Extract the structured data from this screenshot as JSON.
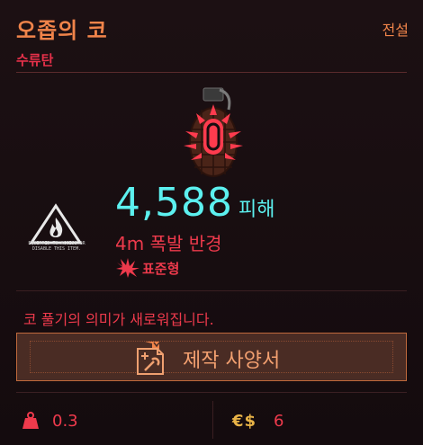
{
  "item": {
    "title": "오좁의 코",
    "rarity": "전설",
    "category": "수류탄"
  },
  "warning": {
    "text": "EQUIPPED TO ACCESS OR DISABLE THIS ITEM."
  },
  "stats": {
    "damage_value": "4,588",
    "damage_label": "피해",
    "radius": "4m 폭발 반경",
    "type_label": "표준형"
  },
  "description": "코 풀기의 의미가 새로워집니다.",
  "craft": {
    "label": "제작 사양서"
  },
  "footer": {
    "weight": "0.3",
    "price_icon": "€$",
    "price": "6"
  },
  "colors": {
    "accent_orange": "#f0844a",
    "accent_red": "#ee3a4c",
    "damage_cyan": "#5cf0ef",
    "currency_gold": "#e8b347"
  },
  "icons": [
    "grenade-image",
    "flame-warning-icon",
    "explosion-type-icon",
    "blueprint-icon",
    "weight-icon"
  ]
}
